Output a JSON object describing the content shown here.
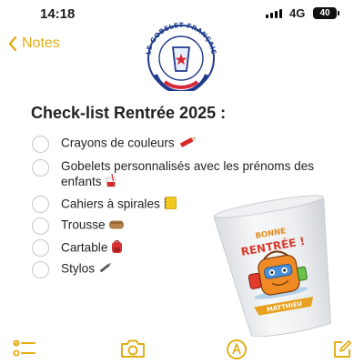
{
  "status_bar": {
    "time": "14:18",
    "network": "4G",
    "battery": "40"
  },
  "nav": {
    "back_label": "Notes"
  },
  "logo": {
    "text": "LE GOBELET FRANÇAIS"
  },
  "note": {
    "title": "Check-list Rentrée 2025 :",
    "items": [
      {
        "label": "Crayons de couleurs",
        "emoji": "crayon-icon",
        "checked": false
      },
      {
        "label": "Gobelets personnalisés avec les prénoms des enfants",
        "emoji": "cup-icon",
        "checked": false
      },
      {
        "label": "Cahiers à spirales",
        "emoji": "notebook-icon",
        "checked": false
      },
      {
        "label": "Trousse",
        "emoji": "pouch-icon",
        "checked": false
      },
      {
        "label": "Cartable",
        "emoji": "backpack-icon",
        "checked": false
      },
      {
        "label": "Stylos",
        "emoji": "pen-icon",
        "checked": false
      }
    ]
  },
  "cup_image": {
    "line1": "BONNE",
    "line2": "RENTRÉE !",
    "name": "MATTHIEU"
  },
  "toolbar": {
    "icons": [
      "checklist-icon",
      "camera-icon",
      "markup-icon",
      "compose-icon"
    ]
  },
  "colors": {
    "accent": "#e2ad13",
    "logo_blue": "#1f3b8c",
    "logo_red": "#d6283a"
  }
}
